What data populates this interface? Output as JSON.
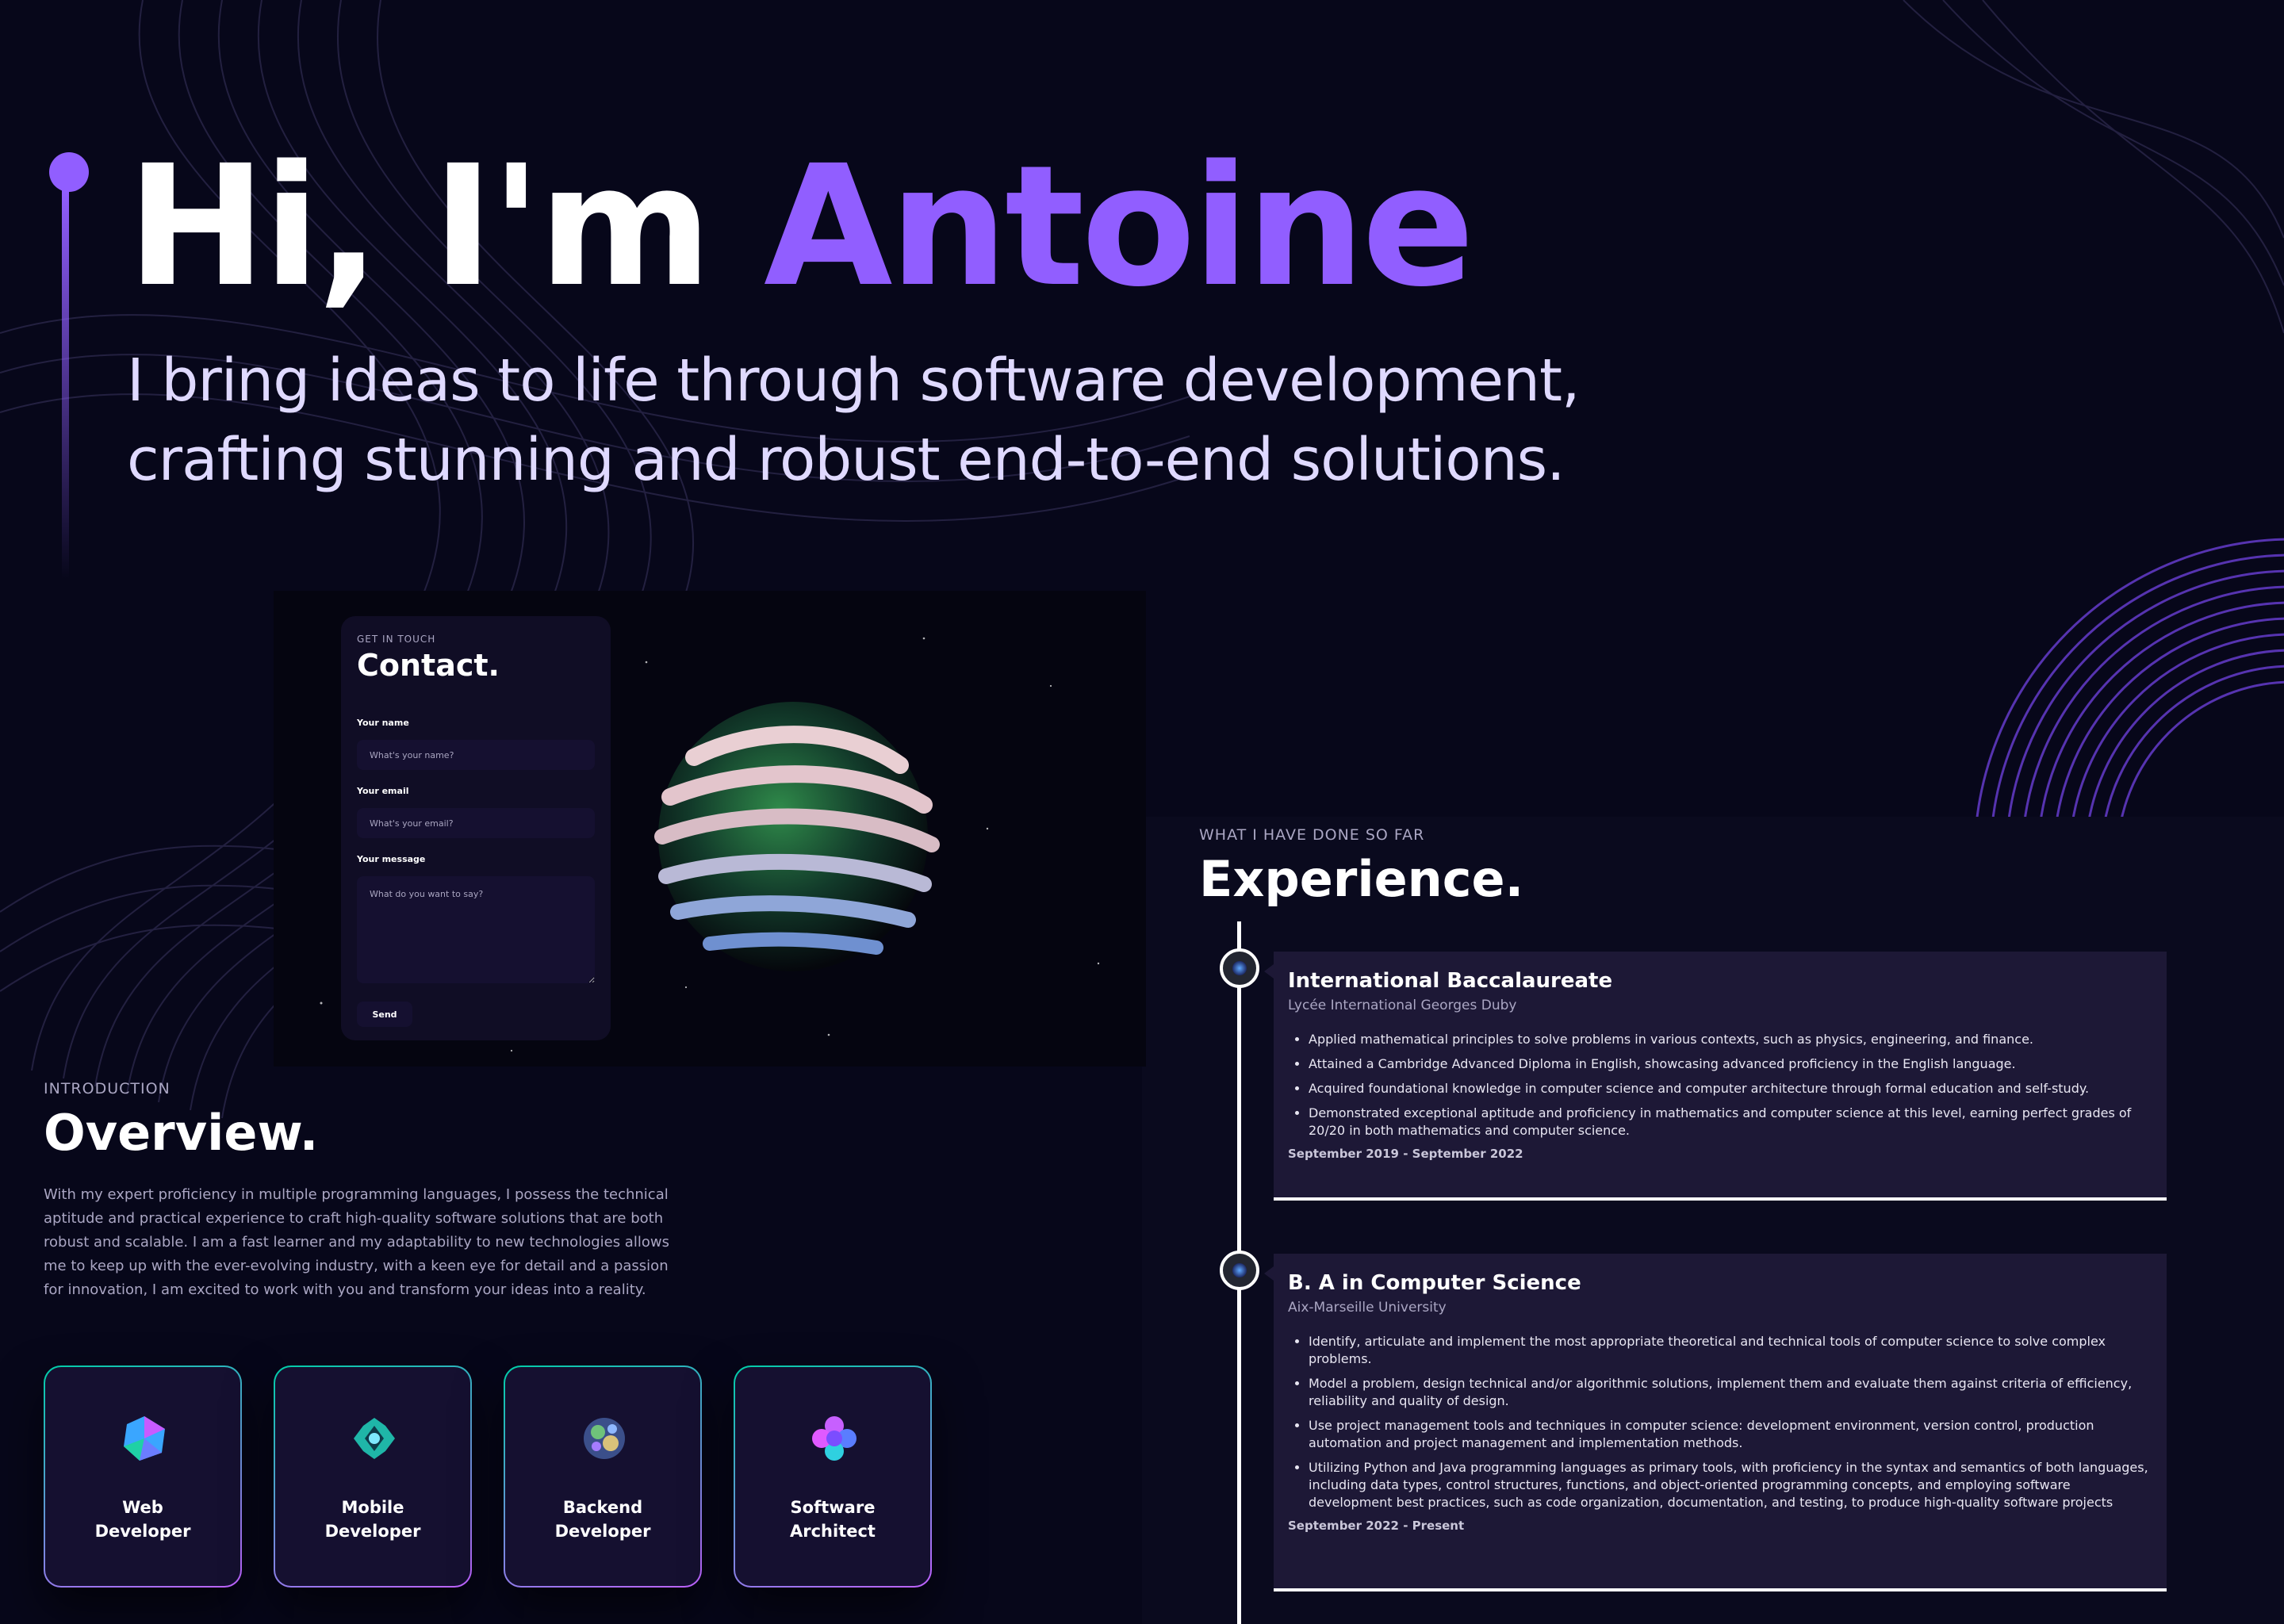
{
  "hero": {
    "greeting": "Hi, I'm",
    "name": "Antoine",
    "subtitle_line1": "I bring ideas to life through software development,",
    "subtitle_line2": "crafting stunning and robust end-to-end solutions."
  },
  "contact": {
    "subtitle": "GET IN TOUCH",
    "title": "Contact.",
    "name_label": "Your name",
    "name_placeholder": "What's your name?",
    "email_label": "Your email",
    "email_placeholder": "What's your email?",
    "message_label": "Your message",
    "message_placeholder": "What do you want to say?",
    "send_label": "Send"
  },
  "overview": {
    "subtitle": "INTRODUCTION",
    "title": "Overview.",
    "text": "With my expert proficiency in multiple programming languages, I possess the technical aptitude and practical experience to craft high-quality software solutions that are both robust and scalable. I am a fast learner and my adaptability to new technologies allows me to keep up with the ever-evolving industry, with a keen eye for detail and a passion for innovation, I am excited to work with you and transform your ideas into a reality.",
    "services": [
      {
        "label": "Web\nDeveloper",
        "icon": "web-developer-icon"
      },
      {
        "label": "Mobile\nDeveloper",
        "icon": "mobile-developer-icon"
      },
      {
        "label": "Backend\nDeveloper",
        "icon": "backend-developer-icon"
      },
      {
        "label": "Software\nArchitect",
        "icon": "software-architect-icon"
      }
    ]
  },
  "experience": {
    "subtitle": "WHAT I HAVE DONE SO FAR",
    "title": "Experience.",
    "items": [
      {
        "title": "International Baccalaureate",
        "org": "Lycée International Georges Duby",
        "points": [
          "Applied mathematical principles to solve problems in various contexts, such as physics, engineering, and finance.",
          "Attained a Cambridge Advanced Diploma in English, showcasing advanced proficiency in the English language.",
          "Acquired foundational knowledge in computer science and computer architecture through formal education and self-study.",
          "Demonstrated exceptional aptitude and proficiency in mathematics and computer science at this level, earning perfect grades of 20/20 in both mathematics and computer science."
        ],
        "date": "September 2019 - September 2022"
      },
      {
        "title": "B. A in Computer Science",
        "org": "Aix-Marseille University",
        "points": [
          "Identify, articulate and implement the most appropriate theoretical and technical tools of computer science to solve complex problems.",
          "Model a problem, design technical and/or algorithmic solutions, implement them and evaluate them against criteria of efficiency, reliability and quality of design.",
          "Use project management tools and techniques in computer science: development environment, version control, production automation and project management and implementation methods.",
          "Utilizing Python and Java programming languages as primary tools, with proficiency in the syntax and semantics of both languages, including data types, control structures, functions, and object-oriented programming concepts, and employing software development best practices, such as code organization, documentation, and testing, to produce high-quality software projects"
        ],
        "date": "September 2022 - Present"
      }
    ]
  },
  "colors": {
    "background": "#07071a",
    "accent": "#915eff",
    "card": "#1d1836",
    "secondary_text": "#aaa6c3"
  }
}
